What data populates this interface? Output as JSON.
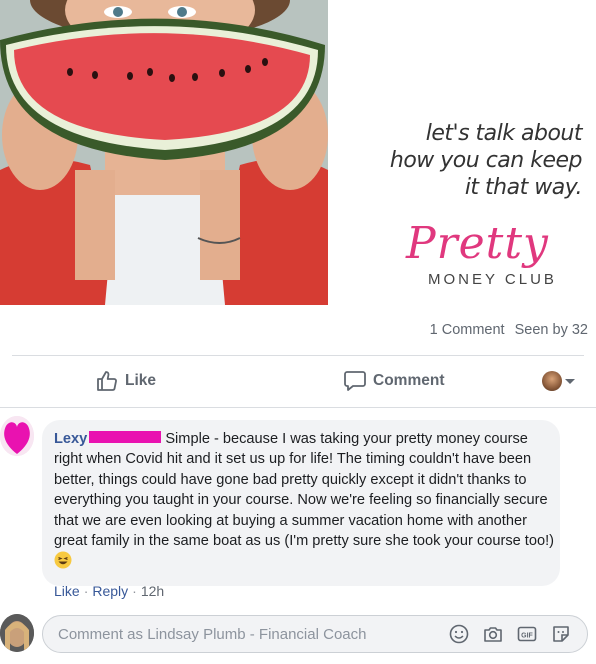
{
  "post": {
    "image": {
      "quote_lines": [
        "let's talk about",
        "how you can keep",
        "it that way."
      ],
      "logo_script": "Pretty",
      "logo_sub": "MONEY CLUB"
    },
    "stats": {
      "comments": "1 Comment",
      "seen_by": "Seen by 32"
    }
  },
  "actions": {
    "like_label": "Like",
    "comment_label": "Comment",
    "audience_icon": "caret-down-icon"
  },
  "comment": {
    "author": "Lexy",
    "text": "Simple - because I was taking your pretty money course right when Covid hit and it set us up for life! The timing couldn't have been better, things could have gone bad pretty quickly except it didn't thanks to everything you taught in your course. Now we're feeling so financially secure that we are even looking at buying a summer vacation home with another great family in the same boat as us (I'm pretty sure she took your course too!)",
    "like_label": "Like",
    "reply_label": "Reply",
    "timestamp": "12h"
  },
  "composer": {
    "placeholder": "Comment as Lindsay Plumb - Financial Coach",
    "icons": [
      "emoji-icon",
      "camera-icon",
      "gif-icon",
      "sticker-icon"
    ]
  },
  "colors": {
    "link": "#385898",
    "muted": "#606770",
    "bubble": "#f2f3f5",
    "logo_pink": "#e0387e",
    "redaction": "#e912b0"
  }
}
